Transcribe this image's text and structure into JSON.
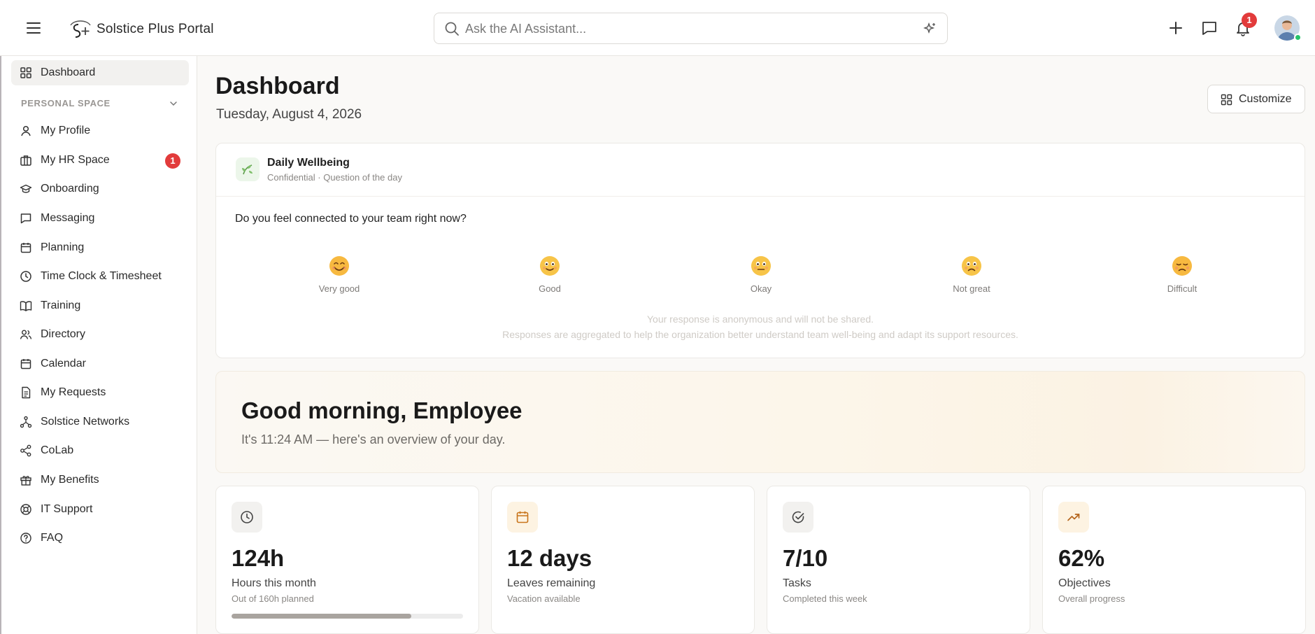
{
  "app": {
    "title": "Solstice Plus Portal"
  },
  "header": {
    "search_placeholder": "Ask the AI Assistant...",
    "notifications_count": "1"
  },
  "sidebar": {
    "section_label": "PERSONAL SPACE",
    "items": [
      {
        "label": "Dashboard",
        "icon": "grid-icon"
      },
      {
        "label": "My Profile",
        "icon": "user-icon"
      },
      {
        "label": "My HR Space",
        "icon": "briefcase-icon",
        "badge": "1"
      },
      {
        "label": "Onboarding",
        "icon": "graduation-cap-icon"
      },
      {
        "label": "Messaging",
        "icon": "message-icon"
      },
      {
        "label": "Planning",
        "icon": "calendar-icon"
      },
      {
        "label": "Time Clock & Timesheet",
        "icon": "clock-icon"
      },
      {
        "label": "Training",
        "icon": "book-icon"
      },
      {
        "label": "Directory",
        "icon": "users-icon"
      },
      {
        "label": "Calendar",
        "icon": "calendar-icon"
      },
      {
        "label": "My Requests",
        "icon": "document-icon"
      },
      {
        "label": "Solstice Networks",
        "icon": "network-icon"
      },
      {
        "label": "CoLab",
        "icon": "share-icon"
      },
      {
        "label": "My Benefits",
        "icon": "gift-icon"
      },
      {
        "label": "IT Support",
        "icon": "lifebuoy-icon"
      },
      {
        "label": "FAQ",
        "icon": "help-icon"
      }
    ]
  },
  "page": {
    "title": "Dashboard",
    "date": "Tuesday, August 4, 2026",
    "customize_label": "Customize"
  },
  "wellbeing": {
    "title": "Daily Wellbeing",
    "subtitle": "Confidential · Question of the day",
    "question": "Do you feel connected to your team right now?",
    "options": [
      "Very good",
      "Good",
      "Okay",
      "Not great",
      "Difficult"
    ],
    "note1": "Your response is anonymous and will not be shared.",
    "note2": "Responses are aggregated to help the organization better understand team well-being and adapt its support resources."
  },
  "greeting": {
    "title": "Good morning, Employee",
    "subtitle": "It's 11:24 AM — here's an overview of your day."
  },
  "stats": [
    {
      "value": "124h",
      "label": "Hours this month",
      "sub": "Out of 160h planned",
      "icon": "clock-icon",
      "progress": 0.775
    },
    {
      "value": "12 days",
      "label": "Leaves remaining",
      "sub": "Vacation available",
      "icon": "calendar-icon"
    },
    {
      "value": "7/10",
      "label": "Tasks",
      "sub": "Completed this week",
      "icon": "check-circle-icon"
    },
    {
      "value": "62%",
      "label": "Objectives",
      "sub": "Overall progress",
      "icon": "trending-up-icon"
    }
  ],
  "colors": {
    "accent_red": "#e23b3b",
    "online_green": "#27c36a",
    "calendar_orange": "#c8741a",
    "trend_orange": "#b5651d"
  }
}
